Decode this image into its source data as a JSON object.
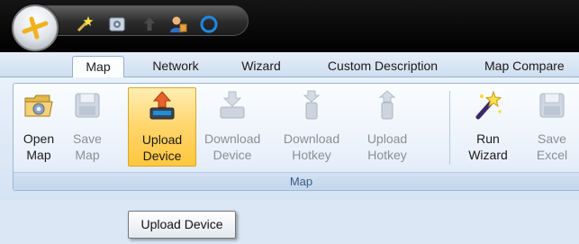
{
  "tabs": [
    {
      "label": "Map",
      "active": true
    },
    {
      "label": "Network",
      "active": false
    },
    {
      "label": "Wizard",
      "active": false
    },
    {
      "label": "Custom Description",
      "active": false
    },
    {
      "label": "Map Compare",
      "active": false
    }
  ],
  "ribbon": {
    "group_label": "Map",
    "buttons": [
      {
        "name": "open-map",
        "line1": "Open",
        "line2": "Map",
        "icon": "open-map-icon",
        "enabled": true
      },
      {
        "name": "save-map",
        "line1": "Save",
        "line2": "Map",
        "icon": "save-map-icon",
        "enabled": false
      },
      {
        "name": "upload-device",
        "line1": "Upload",
        "line2": "Device",
        "icon": "upload-device-icon",
        "enabled": true,
        "hovered": true
      },
      {
        "name": "download-device",
        "line1": "Download",
        "line2": "Device",
        "icon": "download-device-icon",
        "enabled": false
      },
      {
        "name": "download-hotkey",
        "line1": "Download",
        "line2": "Hotkey",
        "icon": "download-hotkey-icon",
        "enabled": false
      },
      {
        "name": "upload-hotkey",
        "line1": "Upload",
        "line2": "Hotkey",
        "icon": "upload-hotkey-icon",
        "enabled": false
      },
      {
        "name": "run-wizard",
        "line1": "Run",
        "line2": "Wizard",
        "icon": "magic-wand-icon",
        "enabled": true
      },
      {
        "name": "save-excel",
        "line1": "Save",
        "line2": "Excel",
        "icon": "save-excel-icon",
        "enabled": false
      }
    ]
  },
  "tooltip": {
    "text": "Upload Device"
  },
  "quick_access": [
    "wizard-icon",
    "settings-icon",
    "user-icon",
    "upload-icon",
    "circle-icon"
  ],
  "colors": {
    "hover": "#ffd56b",
    "accent": "#1e88e5"
  }
}
